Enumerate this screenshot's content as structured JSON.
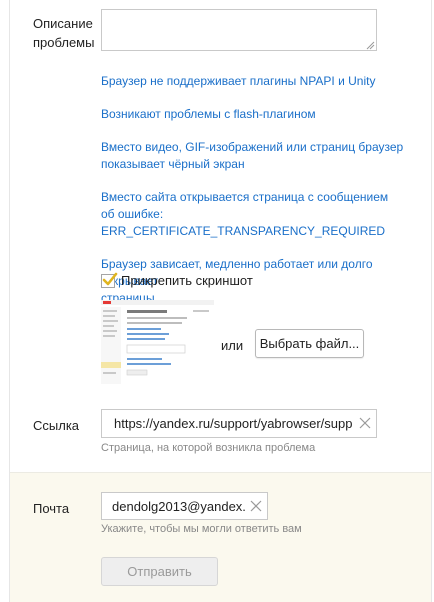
{
  "form": {
    "description_label_line1": "Описание",
    "description_label_line2": "проблемы",
    "description_value": "",
    "link_label": "Ссылка",
    "email_label": "Почта"
  },
  "suggestions": [
    {
      "text": "Браузер не поддерживает плагины NPAPI и Unity"
    },
    {
      "text": "Возникают проблемы с flash-плагином"
    },
    {
      "line1": "Вместо видео, GIF-изображений или страниц браузер",
      "line2": "показывает чёрный экран"
    },
    {
      "line1": "Вместо сайта открывается страница с сообщением",
      "line2": "об ошибке: ERR_CERTIFICATE_TRANSPARENCY_REQUIRED"
    },
    {
      "line1": "Браузер зависает, медленно работает или долго открывает",
      "line2": "страницы."
    }
  ],
  "attachment": {
    "checkbox_label": "Прикрепить скриншот",
    "checked": true,
    "or_text": "или",
    "choose_file_label": "Выбрать файл..."
  },
  "url": {
    "value": "https://yandex.ru/support/yabrowser/support/",
    "hint": "Страница, на которой возникла проблема"
  },
  "email": {
    "value": "dendolg2013@yandex.ru",
    "hint": "Укажите, чтобы мы могли ответить вам"
  },
  "submit_label": "Отправить",
  "colors": {
    "link": "#1a6fc9",
    "checkmark": "#e0b520",
    "footer_bg": "#fbf9ee"
  }
}
